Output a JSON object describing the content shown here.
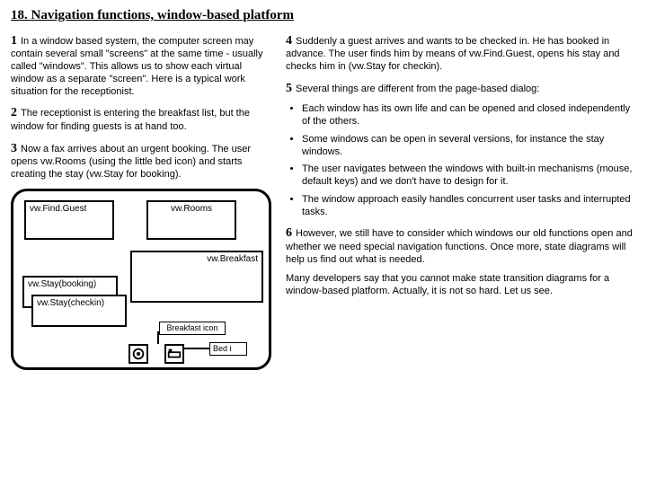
{
  "title": "18. Navigation functions, window-based platform",
  "left": {
    "p1": "In a window based system, the computer screen may contain several small \"screens\" at the same time - usually called \"windows\". This allows us to show each virtual window as a separate \"screen\". Here is a typical work situation for the receptionist.",
    "p2": "The receptionist is entering the breakfast list, but the window for finding guests is at hand too.",
    "p3": "Now a fax arrives about an urgent booking. The user opens vw.Rooms (using the little bed icon) and starts creating the stay (vw.Stay for booking).",
    "win_find": "vw.Find.Guest",
    "win_rooms": "vw.Rooms",
    "win_bfast": "vw.Breakfast",
    "win_stay_booking": "vw.Stay(booking)",
    "win_stay_checkin": "vw.Stay(checkin)",
    "label_breakfast_icon": "Breakfast icon",
    "label_bed_icon": "Bed i"
  },
  "right": {
    "p4": "Suddenly a guest arrives and wants to be checked in. He has booked in advance. The user finds him by means of vw.Find.Guest, opens his stay and checks him in (vw.Stay for checkin).",
    "p5": "Several things are different from the page-based dialog:",
    "bullets": [
      "Each window has its own life and can be opened and closed independently of the others.",
      "Some windows can be open in several versions, for instance the stay windows.",
      "The user navigates between the windows with built-in mechanisms (mouse, default keys) and we don't have to design for it.",
      "The window approach easily handles concurrent user tasks and interrupted tasks."
    ],
    "p6": "However, we still have to consider which windows our old functions open and whether we need special navigation functions. Once more, state diagrams will help us find out what is needed.",
    "p_end": "Many developers say that you cannot make state transition diagrams for a window-based platform. Actually, it is not so hard. Let us see."
  },
  "nums": {
    "n1": "1",
    "n2": "2",
    "n3": "3",
    "n4": "4",
    "n5": "5",
    "n6": "6"
  }
}
